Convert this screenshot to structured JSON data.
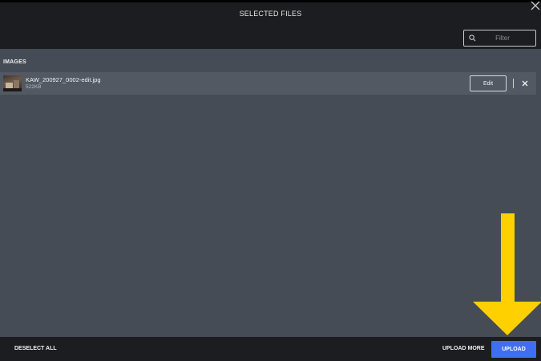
{
  "window": {
    "title": "SELECTED FILES"
  },
  "filter": {
    "placeholder": "Filter",
    "value": ""
  },
  "section": {
    "label": "IMAGES"
  },
  "files": [
    {
      "name": "KAW_200927_0002-edit.jpg",
      "size": "522KB",
      "edit_label": "Edit"
    }
  ],
  "footer": {
    "deselect_label": "DESELECT ALL",
    "upload_more_label": "UPLOAD MORE",
    "upload_label": "UPLOAD"
  },
  "icons": {
    "close": "close-icon",
    "search": "search-icon",
    "remove": "close-icon",
    "annotation": "arrow-down-icon"
  },
  "colors": {
    "accent": "#3f6ff0",
    "annotation_arrow": "#ffd000",
    "panel_bg": "#454c55",
    "header_bg": "#1c1d20"
  }
}
